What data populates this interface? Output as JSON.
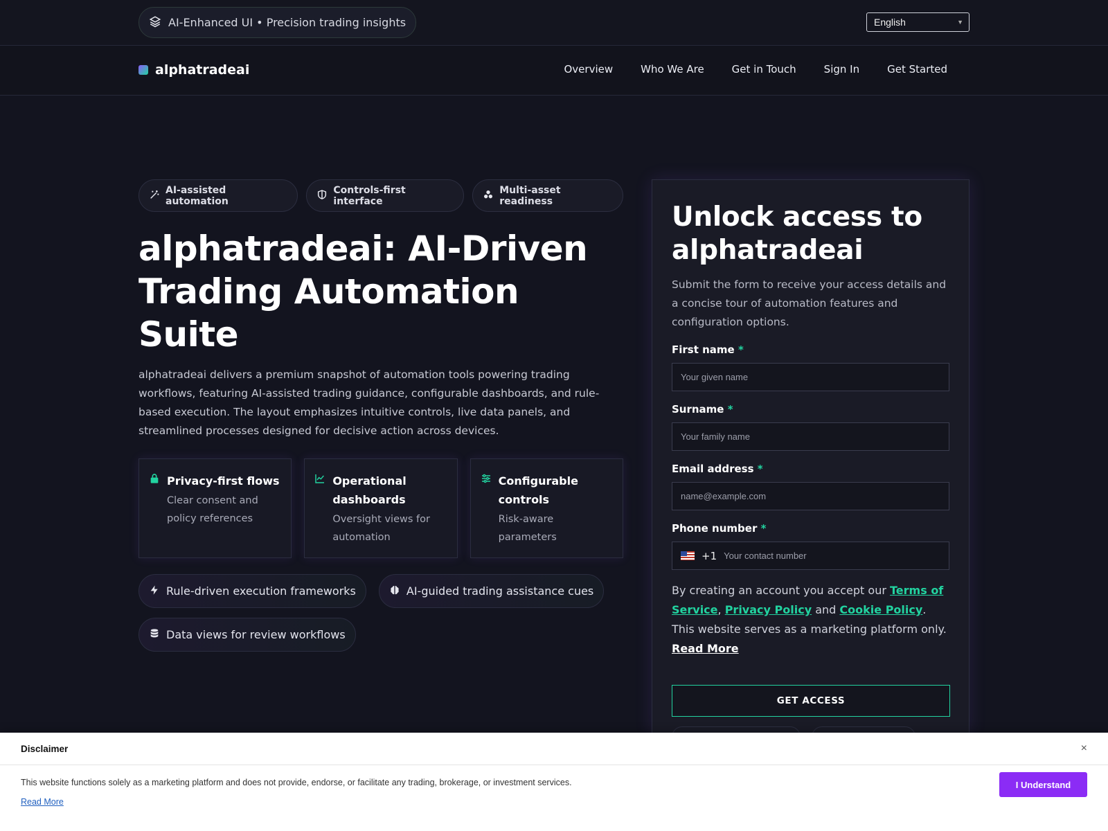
{
  "topbar": {
    "pill_text": "AI-Enhanced UI • Precision trading insights",
    "language": "English"
  },
  "nav": {
    "brand": "alphatradeai",
    "links": [
      "Overview",
      "Who We Are",
      "Get in Touch",
      "Sign In",
      "Get Started"
    ]
  },
  "hero": {
    "tags": [
      "AI-assisted automation",
      "Controls-first interface",
      "Multi-asset readiness"
    ],
    "title": "alphatradeai: AI-Driven Trading Automation Suite",
    "description": "alphatradeai delivers a premium snapshot of automation tools powering trading workflows, featuring AI-assisted trading guidance, configurable dashboards, and rule-based execution. The layout emphasizes intuitive controls, live data panels, and streamlined processes designed for decisive action across devices.",
    "features": [
      {
        "title": "Privacy-first flows",
        "sub": "Clear consent and policy references"
      },
      {
        "title": "Operational dashboards",
        "sub": "Oversight views for automation"
      },
      {
        "title": "Configurable controls",
        "sub": "Risk-aware parameters"
      }
    ],
    "chips": [
      "Rule-driven execution frameworks",
      "AI-guided trading assistance cues",
      "Data views for review workflows"
    ]
  },
  "form": {
    "title": "Unlock access to alphatradeai",
    "subtitle": "Submit the form to receive your access details and a concise tour of automation features and configuration options.",
    "first_name_label": "First name",
    "first_name_placeholder": "Your given name",
    "surname_label": "Surname",
    "surname_placeholder": "Your family name",
    "email_label": "Email address",
    "email_placeholder": "name@example.com",
    "phone_label": "Phone number",
    "phone_dial": "+1",
    "phone_placeholder": "Your contact number",
    "required_mark": "*",
    "terms_prefix": "By creating an account you accept our",
    "terms_link": "Terms of Service",
    "comma": ",",
    "privacy_link": "Privacy Policy",
    "and": "and",
    "cookie_link": "Cookie Policy",
    "terms_suffix": ". This website serves as a marketing platform only.",
    "read_more": "Read More",
    "submit": "GET ACCESS"
  },
  "disclaimer": {
    "title": "Disclaimer",
    "close": "×",
    "text": "This website functions solely as a marketing platform and does not provide, endorse, or facilitate any trading, brokerage, or investment services.",
    "read_more": "Read More",
    "button": "I Understand"
  },
  "colors": {
    "background": "#13141f",
    "accent_green": "#22d3a0",
    "accent_purple": "#8b2cf5"
  }
}
